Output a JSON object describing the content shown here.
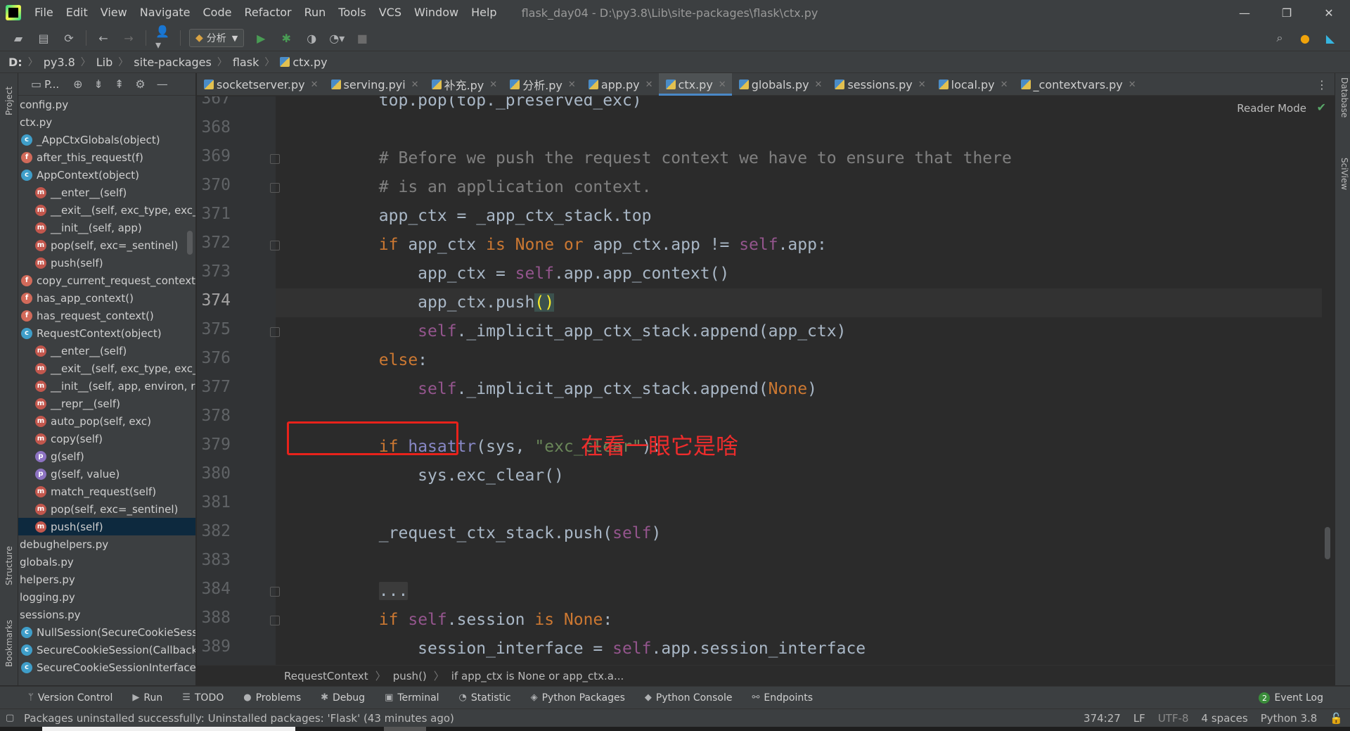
{
  "window": {
    "title": "flask_day04 - D:\\py3.8\\Lib\\site-packages\\flask\\ctx.py",
    "menu": [
      "File",
      "Edit",
      "View",
      "Navigate",
      "Code",
      "Refactor",
      "Run",
      "Tools",
      "VCS",
      "Window",
      "Help"
    ],
    "controls": [
      "—",
      "❐",
      "✕"
    ]
  },
  "toolbar": {
    "run_config": "分析"
  },
  "breadcrumb": [
    "D:",
    "py3.8",
    "Lib",
    "site-packages",
    "flask",
    "ctx.py"
  ],
  "project_panel": {
    "title": "P...",
    "items": [
      {
        "label": "config.py",
        "icon": "file",
        "indent": 0
      },
      {
        "label": "ctx.py",
        "icon": "file",
        "indent": 0
      },
      {
        "label": "_AppCtxGlobals(object)",
        "icon": "c",
        "indent": 1
      },
      {
        "label": "after_this_request(f)",
        "icon": "f",
        "indent": 1
      },
      {
        "label": "AppContext(object)",
        "icon": "c",
        "indent": 1
      },
      {
        "label": "__enter__(self)",
        "icon": "m",
        "indent": 2
      },
      {
        "label": "__exit__(self, exc_type, exc_",
        "icon": "m",
        "indent": 2
      },
      {
        "label": "__init__(self, app)",
        "icon": "m",
        "indent": 2
      },
      {
        "label": "pop(self, exc=_sentinel)",
        "icon": "m",
        "indent": 2
      },
      {
        "label": "push(self)",
        "icon": "m",
        "indent": 2
      },
      {
        "label": "copy_current_request_context",
        "icon": "f",
        "indent": 1
      },
      {
        "label": "has_app_context()",
        "icon": "f",
        "indent": 1
      },
      {
        "label": "has_request_context()",
        "icon": "f",
        "indent": 1
      },
      {
        "label": "RequestContext(object)",
        "icon": "c",
        "indent": 1
      },
      {
        "label": "__enter__(self)",
        "icon": "m",
        "indent": 2
      },
      {
        "label": "__exit__(self, exc_type, exc_",
        "icon": "m",
        "indent": 2
      },
      {
        "label": "__init__(self, app, environ, re",
        "icon": "m",
        "indent": 2
      },
      {
        "label": "__repr__(self)",
        "icon": "m",
        "indent": 2
      },
      {
        "label": "auto_pop(self, exc)",
        "icon": "m",
        "indent": 2
      },
      {
        "label": "copy(self)",
        "icon": "m",
        "indent": 2
      },
      {
        "label": "g(self)",
        "icon": "p",
        "indent": 2
      },
      {
        "label": "g(self, value)",
        "icon": "p",
        "indent": 2
      },
      {
        "label": "match_request(self)",
        "icon": "m",
        "indent": 2
      },
      {
        "label": "pop(self, exc=_sentinel)",
        "icon": "m",
        "indent": 2
      },
      {
        "label": "push(self)",
        "icon": "m",
        "indent": 2,
        "selected": true
      },
      {
        "label": "debughelpers.py",
        "icon": "file",
        "indent": 0
      },
      {
        "label": "globals.py",
        "icon": "file",
        "indent": 0
      },
      {
        "label": "helpers.py",
        "icon": "file",
        "indent": 0
      },
      {
        "label": "logging.py",
        "icon": "file",
        "indent": 0
      },
      {
        "label": "sessions.py",
        "icon": "file",
        "indent": 0
      },
      {
        "label": "NullSession(SecureCookieSess",
        "icon": "c",
        "indent": 1
      },
      {
        "label": "SecureCookieSession(Callback",
        "icon": "c",
        "indent": 1
      },
      {
        "label": "SecureCookieSessionInterface",
        "icon": "c",
        "indent": 1
      }
    ]
  },
  "left_strip": [
    "Project",
    "Structure",
    "Bookmarks"
  ],
  "right_strip": [
    "Database",
    "SciView"
  ],
  "tabs": [
    {
      "label": "socketserver.py",
      "active": false
    },
    {
      "label": "serving.pyi",
      "active": false
    },
    {
      "label": "补充.py",
      "active": false
    },
    {
      "label": "分析.py",
      "active": false
    },
    {
      "label": "app.py",
      "active": false
    },
    {
      "label": "ctx.py",
      "active": true
    },
    {
      "label": "globals.py",
      "active": false
    },
    {
      "label": "sessions.py",
      "active": false
    },
    {
      "label": "local.py",
      "active": false
    },
    {
      "label": "_contextvars.py",
      "active": false
    }
  ],
  "editor": {
    "reader_mode": "Reader Mode",
    "current_line": "374",
    "lines": [
      {
        "no": "367",
        "html": "        top.pop(top._preserved_exc)"
      },
      {
        "no": "368",
        "html": ""
      },
      {
        "no": "369",
        "html": "        <span class=\"cm\"># Before we push the request context we have to ensure that there</span>"
      },
      {
        "no": "370",
        "html": "        <span class=\"cm\"># is an application context.</span>"
      },
      {
        "no": "371",
        "html": "        app_ctx = _app_ctx_stack.top"
      },
      {
        "no": "372",
        "html": "        <span class=\"kw\">if</span> app_ctx <span class=\"kw\">is</span> <span class=\"kw\">None</span> <span class=\"kw\">or</span> app_ctx.app != <span class=\"self\">self</span>.app:"
      },
      {
        "no": "373",
        "html": "            app_ctx = <span class=\"self\">self</span>.app.app_context()"
      },
      {
        "no": "374",
        "html": "            app_ctx.push<span class=\"paren-match\">()</span>"
      },
      {
        "no": "375",
        "html": "            <span class=\"self\">self</span>._implicit_app_ctx_stack.append(app_ctx)"
      },
      {
        "no": "376",
        "html": "        <span class=\"kw\">else</span>:"
      },
      {
        "no": "377",
        "html": "            <span class=\"self\">self</span>._implicit_app_ctx_stack.append(<span class=\"kw\">None</span>)"
      },
      {
        "no": "378",
        "html": ""
      },
      {
        "no": "379",
        "html": "        <span class=\"kw\">if</span> <span class=\"bi\">hasattr</span>(sys, <span class=\"str\">\"exc_clear\"</span>):"
      },
      {
        "no": "380",
        "html": "            sys.exc_clear()"
      },
      {
        "no": "381",
        "html": ""
      },
      {
        "no": "382",
        "html": "        _request_ctx_stack.push(<span class=\"self\">self</span>)"
      },
      {
        "no": "383",
        "html": ""
      },
      {
        "no": "384",
        "html": "        <span class=\"fold-ph\">...</span>"
      },
      {
        "no": "388",
        "html": "        <span class=\"kw\">if</span> <span class=\"self\">self</span>.session <span class=\"kw\">is</span> <span class=\"kw\">None</span>:"
      },
      {
        "no": "389",
        "html": "            session_interface = <span class=\"self\">self</span>.app.session_interface"
      }
    ],
    "annotation": "在看一眼它是啥"
  },
  "code_breadcrumb": [
    "RequestContext",
    "push()",
    "if app_ctx is None or app_ctx.a..."
  ],
  "tool_windows": [
    {
      "label": "Version Control",
      "icon": "ᛘ"
    },
    {
      "label": "Run",
      "icon": "▶"
    },
    {
      "label": "TODO",
      "icon": "☰"
    },
    {
      "label": "Problems",
      "icon": "●"
    },
    {
      "label": "Debug",
      "icon": "✱"
    },
    {
      "label": "Terminal",
      "icon": "▣"
    },
    {
      "label": "Statistic",
      "icon": "◔"
    },
    {
      "label": "Python Packages",
      "icon": "◈"
    },
    {
      "label": "Python Console",
      "icon": "◆"
    },
    {
      "label": "Endpoints",
      "icon": "⚯"
    }
  ],
  "event_log": {
    "label": "Event Log",
    "count": "2"
  },
  "status": {
    "message": "Packages uninstalled successfully: Uninstalled packages: 'Flask' (43 minutes ago)",
    "position": "374:27",
    "line_sep": "LF",
    "encoding": "UTF-8",
    "indent": "4 spaces",
    "interpreter": "Python 3.8"
  },
  "colors": {
    "accent": "#4a88c7",
    "annotation": "#e8221b",
    "keyword": "#cc7832",
    "self": "#94558d",
    "comment": "#808080",
    "string": "#6a8759"
  }
}
